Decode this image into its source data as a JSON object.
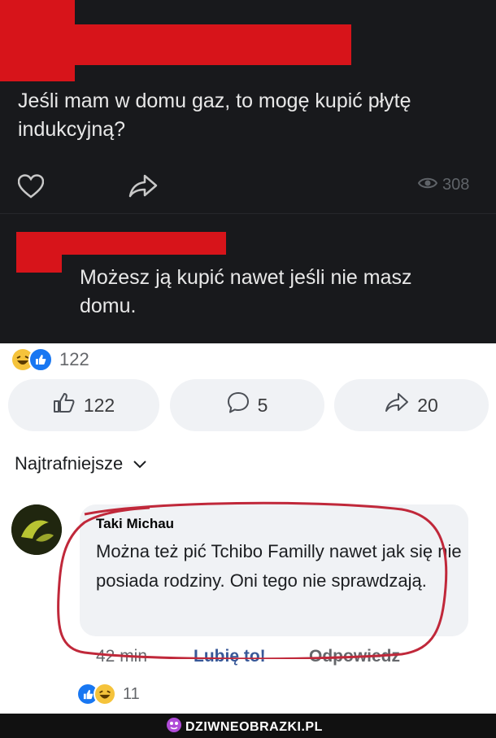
{
  "post": {
    "question": "Jeśli mam w domu gaz, to mogę kupić płytę indukcyjną?",
    "views": "308"
  },
  "reply": {
    "text": "Możesz ją kupić nawet jeśli nie masz domu."
  },
  "reactions": {
    "count": "122"
  },
  "actions": {
    "like_count": "122",
    "comments_count": "5",
    "shares_count": "20"
  },
  "sort": {
    "label": "Najtrafniejsze"
  },
  "comment": {
    "author": "Taki Michau",
    "text": "Można też pić Tchibo Familly nawet jak się nie posiada rodziny. Oni tego nie sprawdzają.",
    "time": "42 min",
    "like_label": "Lubię to!",
    "reply_label": "Odpowiedz",
    "reactions_count": "11"
  },
  "watermark": {
    "text": "DZIWNEOBRAZKI.PL"
  },
  "colors": {
    "dark_bg": "#18191c",
    "redaction": "#d7141a",
    "link_blue": "#385898",
    "annotation_red": "#c0283a"
  }
}
